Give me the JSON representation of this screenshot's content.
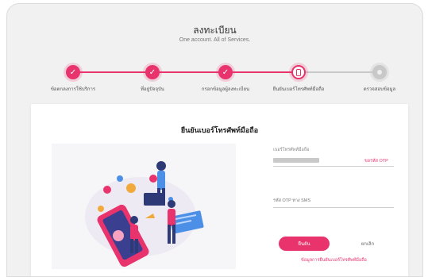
{
  "header": {
    "title": "ลงทะเบียน",
    "subtitle": "One account. All of Services."
  },
  "stepper": {
    "steps": [
      {
        "label": "ข้อตกลงการใช้บริการ",
        "state": "done",
        "icon": "check-icon"
      },
      {
        "label": "ที่อยู่ปัจจุบัน",
        "state": "done",
        "icon": "check-icon"
      },
      {
        "label": "กรอกข้อมูลผู้ลงทะเบียน",
        "state": "done",
        "icon": "check-icon"
      },
      {
        "label": "ยืนยันเบอร์โทรศัพท์มือถือ",
        "state": "current",
        "icon": "phone-icon"
      },
      {
        "label": "ตรวจสอบข้อมูล",
        "state": "todo",
        "icon": "circle-icon"
      }
    ]
  },
  "card": {
    "title": "ยืนยันเบอร์โทรศัพท์มือถือ",
    "phone_label": "เบอร์โทรศัพท์มือถือ",
    "request_otp_label": "ขอรหัส OTP",
    "otp_placeholder": "รหัส OTP ทาง SMS",
    "confirm_label": "ยืนยัน",
    "cancel_label": "ยกเลิก",
    "help_link": "ข้อมูลการยืนยันเบอร์โทรศัพท์มือถือ"
  },
  "colors": {
    "accent": "#e8336d",
    "inactive": "#c8c8c8",
    "background": "#f1f1f1"
  }
}
